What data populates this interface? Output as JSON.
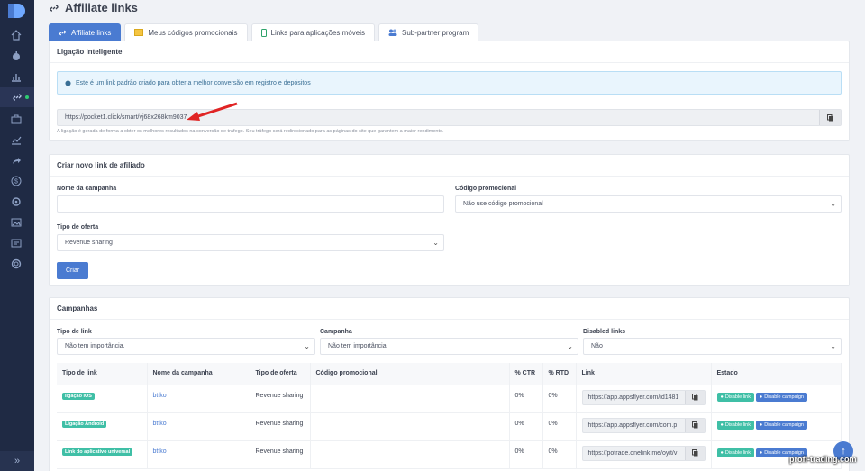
{
  "page": {
    "title": "Affiliate links"
  },
  "tabs": [
    {
      "label": "Affiliate links"
    },
    {
      "label": "Meus códigos promocionais"
    },
    {
      "label": "Links para aplicações móveis"
    },
    {
      "label": "Sub-partner program"
    }
  ],
  "smart_link": {
    "title": "Ligação inteligente",
    "info": "Este é um link padrão criado para obter a melhor conversão em registro e depósitos",
    "url": "https://pocket1.click/smart/vj68x268km9037",
    "note": "A ligação é gerada de forma a obter os melhores resultados na conversão de tráfego. Seu tráfego será redirecionado para as páginas do site que garantem a maior rendimento."
  },
  "create": {
    "title": "Criar novo link de afiliado",
    "campaign_label": "Nome da campanha",
    "campaign_value": "",
    "promo_label": "Código promocional",
    "promo_value": "Não use código promocional",
    "offer_label": "Tipo de oferta",
    "offer_value": "Revenue sharing",
    "create_button": "Criar"
  },
  "campaigns": {
    "title": "Campanhas",
    "filters": [
      {
        "label": "Tipo de link",
        "value": "Não tem importância."
      },
      {
        "label": "Campanha",
        "value": "Não tem importância."
      },
      {
        "label": "Disabled links",
        "value": "Não"
      }
    ],
    "columns": [
      "Tipo de link",
      "Nome da campanha",
      "Tipo de oferta",
      "Código promocional",
      "% CTR",
      "% RTD",
      "Link",
      "Estado"
    ],
    "rows": [
      {
        "type": "ligação iOS",
        "name": "bttko",
        "offer": "Revenue sharing",
        "promo": "",
        "ctr": "0%",
        "rtd": "0%",
        "link": "https://app.appsflyer.com/id1481",
        "disable_link": "Disable link",
        "disable_campaign": "Disable campaign"
      },
      {
        "type": "Ligação Android",
        "name": "bttko",
        "offer": "Revenue sharing",
        "promo": "",
        "ctr": "0%",
        "rtd": "0%",
        "link": "https://app.appsflyer.com/com.p",
        "disable_link": "Disable link",
        "disable_campaign": "Disable campaign"
      },
      {
        "type": "Link do aplicativo universal",
        "name": "bttko",
        "offer": "Revenue sharing",
        "promo": "",
        "ctr": "0%",
        "rtd": "0%",
        "link": "https://potrade.onelink.me/oyit/v",
        "disable_link": "Disable link",
        "disable_campaign": "Disable campaign"
      }
    ]
  },
  "watermark": "profi-trading.com",
  "colors": {
    "primary": "#4a7bd1",
    "sidebar": "#1f2a44",
    "teal": "#3fbfa6",
    "arrow": "#e02424"
  }
}
